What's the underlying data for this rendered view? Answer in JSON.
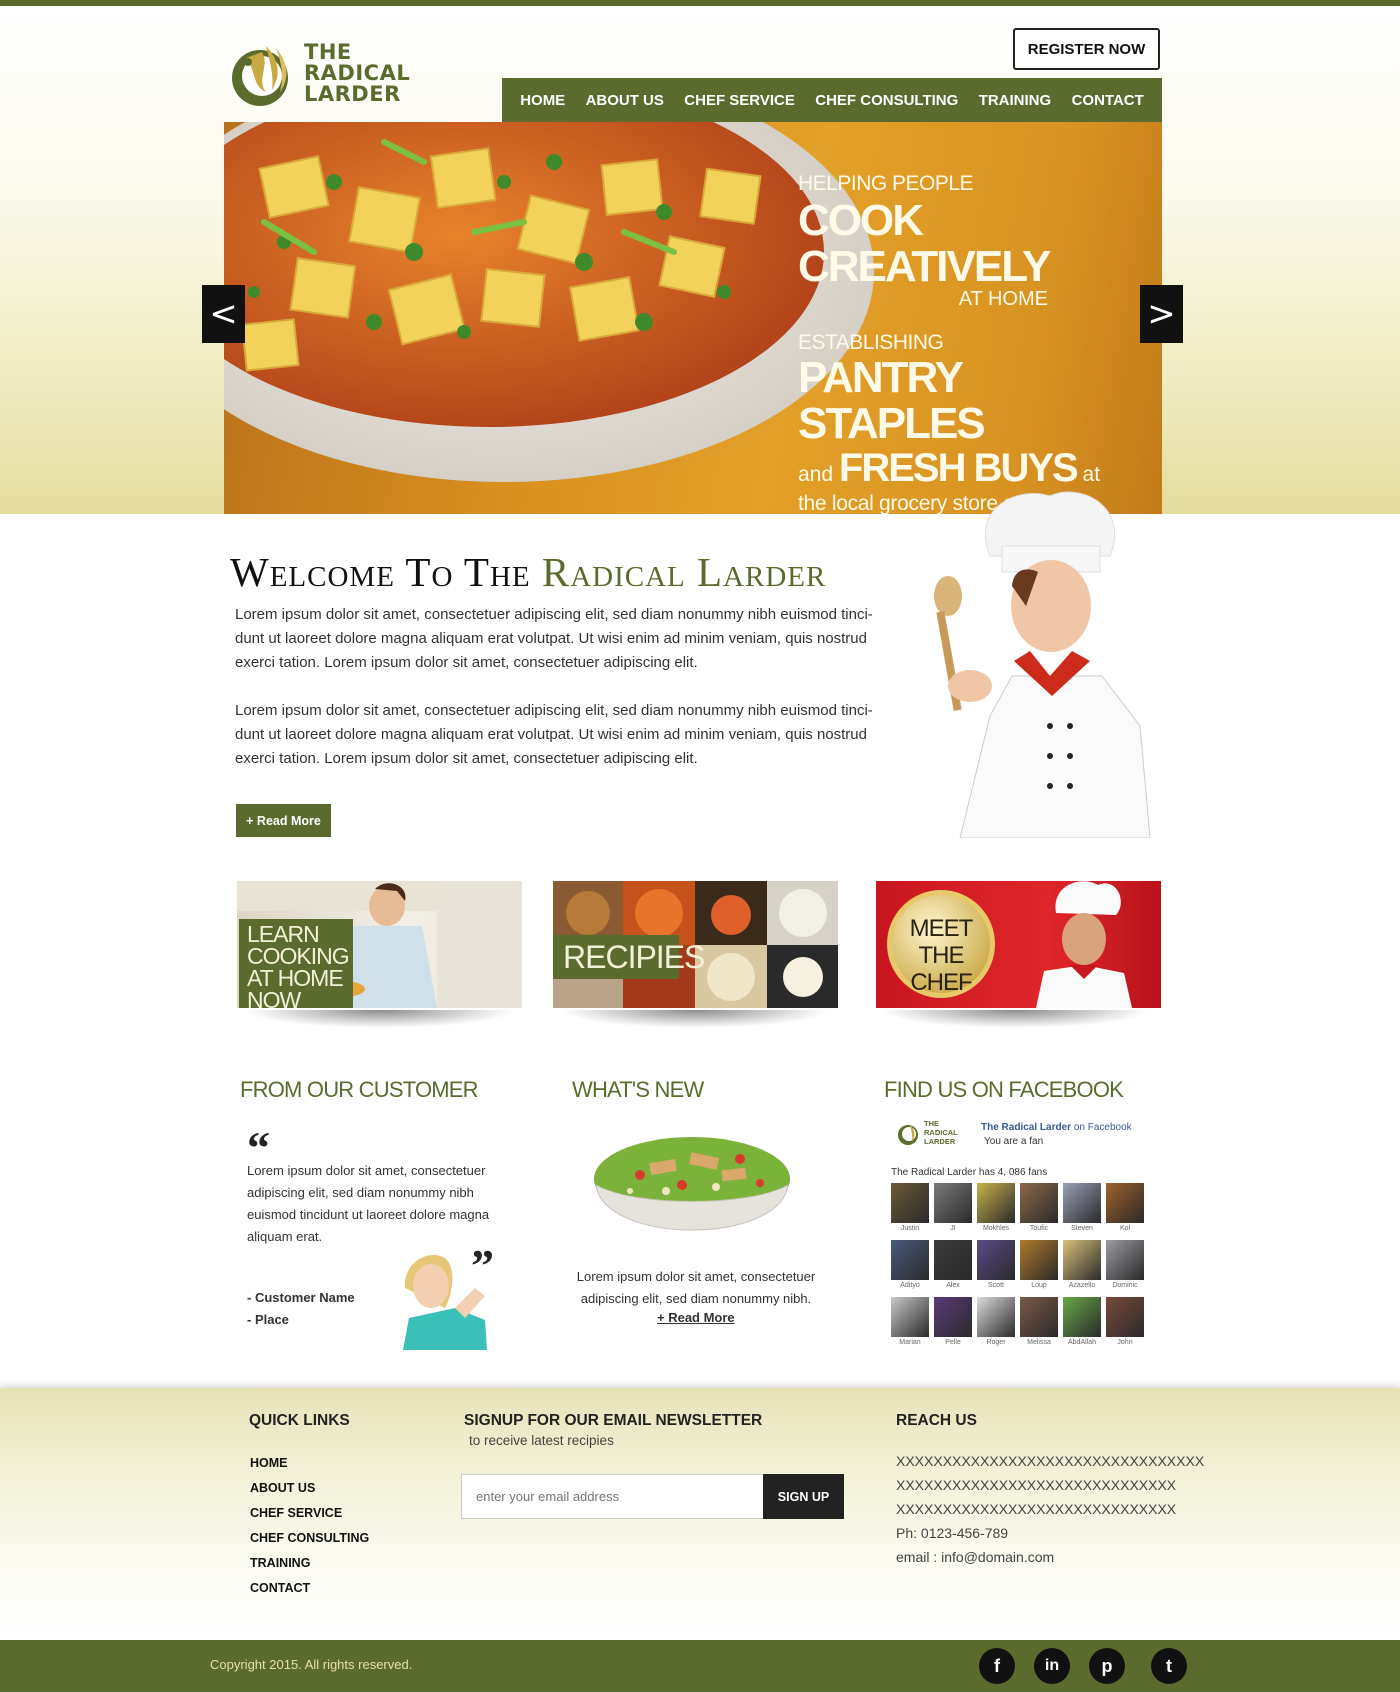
{
  "brand": {
    "name_line1": "THE",
    "name_line2": "RADICAL",
    "name_line3": "LARDER",
    "accent_color": "#5b6b2e"
  },
  "header": {
    "register_label": "REGISTER NOW",
    "nav": [
      "HOME",
      "ABOUT US",
      "CHEF SERVICE",
      "CHEF CONSULTING",
      "TRAINING",
      "CONTACT"
    ]
  },
  "hero": {
    "line1": "HELPING PEOPLE",
    "line2": "COOK CREATIVELY",
    "line3": "AT HOME",
    "line4": "ESTABLISHING",
    "line5": "PANTRY STAPLES",
    "line6_pre": "and",
    "line6_bold": "FRESH BUYS",
    "line6_post": "at",
    "line7": "the local grocery store or market",
    "prev_icon": "chevron-left-icon",
    "next_icon": "chevron-right-icon",
    "prev_glyph": "<",
    "next_glyph": ">"
  },
  "welcome": {
    "title_part1": "Welcome To The",
    "title_part2": "Radical Larder",
    "para1_line1": "Lorem ipsum dolor sit amet, consectetuer adipiscing elit, sed diam nonummy nibh euismod tinci-",
    "para1_line2": "dunt ut laoreet dolore magna aliquam erat volutpat.  Ut wisi enim ad minim veniam, quis nostrud",
    "para1_line3": "exerci tation. Lorem ipsum dolor sit amet, consectetuer adipiscing elit.",
    "para2_line1": "Lorem ipsum dolor sit amet, consectetuer adipiscing elit, sed diam nonummy nibh euismod tinci-",
    "para2_line2": "dunt ut laoreet dolore magna aliquam erat volutpat.  Ut wisi enim ad minim veniam, quis nostrud",
    "para2_line3": "exerci tation. Lorem ipsum dolor sit amet, consectetuer adipiscing elit.",
    "read_more": "+ Read More"
  },
  "tiles": {
    "learn_line1": "LEARN COOKING",
    "learn_line2": "AT HOME NOW",
    "recipes": "RECIPIES",
    "meet_line1": "MEET",
    "meet_line2": "THE CHEF"
  },
  "customer": {
    "title": "FROM OUR CUSTOMER",
    "open_quote": "“",
    "close_quote": "”",
    "text": "Lorem ipsum dolor sit amet, consectetuer adipiscing elit, sed diam nonummy nibh euismod tincidunt ut laoreet dolore magna aliquam erat.",
    "name": "- Customer Name",
    "place": "- Place"
  },
  "whats_new": {
    "title": "WHAT'S NEW",
    "text": "Lorem ipsum dolor sit amet, consectetuer adipiscing elit, sed diam nonummy nibh.",
    "link": "+ Read More"
  },
  "facebook": {
    "title": "FIND US ON FACEBOOK",
    "logo_line1": "THE",
    "logo_line2": "RADICAL",
    "logo_line3": "LARDER",
    "page_name": "The Radical Larder",
    "on_facebook": "on Facebook",
    "fan_status": "You are a fan",
    "fan_count": "The Radical Larder has 4, 086 fans",
    "fans": [
      {
        "name": "Justin",
        "color": "#6b5a3a"
      },
      {
        "name": "JI",
        "color": "#7a7a7a"
      },
      {
        "name": "Mokhles",
        "color": "#c9b24a"
      },
      {
        "name": "Toufic",
        "color": "#8a6a4a"
      },
      {
        "name": "Steven",
        "color": "#9aa0b8"
      },
      {
        "name": "Kol",
        "color": "#a0622a"
      },
      {
        "name": "Adityo",
        "color": "#4a5a7a"
      },
      {
        "name": "Alex",
        "color": "#3a3a3a"
      },
      {
        "name": "Scott",
        "color": "#5a4a8a"
      },
      {
        "name": "Loup",
        "color": "#b07a2a"
      },
      {
        "name": "Azazello",
        "color": "#d8c27a"
      },
      {
        "name": "Dominic",
        "color": "#9a9aa2"
      },
      {
        "name": "Marian",
        "color": "#c8c8c8"
      },
      {
        "name": "Pelle",
        "color": "#5a3a7a"
      },
      {
        "name": "Roger",
        "color": "#dcdcdc"
      },
      {
        "name": "Melissa",
        "color": "#7a5a4a"
      },
      {
        "name": "AbdAllah",
        "color": "#6aa84a"
      },
      {
        "name": "John",
        "color": "#7a4a3a"
      }
    ]
  },
  "footer": {
    "quick_links_title": "QUICK LINKS",
    "quick_links": [
      "HOME",
      "ABOUT US",
      "CHEF SERVICE",
      "CHEF CONSULTING",
      "TRAINING",
      "CONTACT"
    ],
    "newsletter_title": "SIGNUP FOR OUR EMAIL NEWSLETTER",
    "newsletter_sub": "to receive latest recipies",
    "email_placeholder": "enter your email address",
    "signup_label": "SIGN UP",
    "reach_title": "REACH US",
    "address1": "XXXXXXXXXXXXXXXXXXXXXXXXXXXXXXXXX",
    "address2": "XXXXXXXXXXXXXXXXXXXXXXXXXXXXXX",
    "address3": "XXXXXXXXXXXXXXXXXXXXXXXXXXXXXX",
    "phone": "Ph: 0123-456-789",
    "email": "email : info@domain.com",
    "copyright": "Copyright 2015. All rights reserved.",
    "social": [
      {
        "icon": "facebook-icon",
        "glyph": "f"
      },
      {
        "icon": "linkedin-icon",
        "glyph": "in"
      },
      {
        "icon": "pinterest-icon",
        "glyph": "p"
      },
      {
        "icon": "twitter-icon",
        "glyph": "t"
      }
    ]
  }
}
